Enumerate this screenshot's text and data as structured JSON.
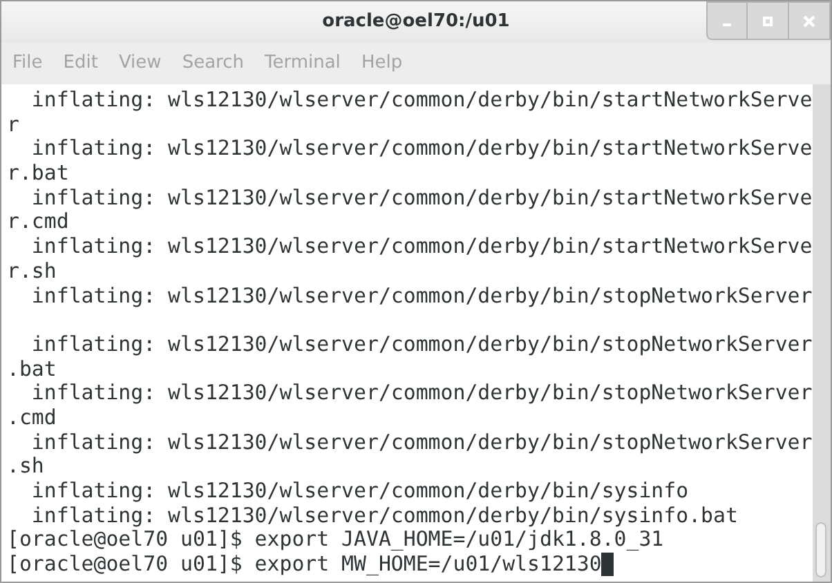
{
  "window": {
    "title": "oracle@oel70:/u01"
  },
  "menu": [
    "File",
    "Edit",
    "View",
    "Search",
    "Terminal",
    "Help"
  ],
  "terminal": {
    "lines": [
      {
        "kind": "text",
        "text": "  inflating: wls12130/wlserver/common/derby/bin/startNetworkServe"
      },
      {
        "kind": "text",
        "text": "r"
      },
      {
        "kind": "text",
        "text": "  inflating: wls12130/wlserver/common/derby/bin/startNetworkServe"
      },
      {
        "kind": "text",
        "text": "r.bat"
      },
      {
        "kind": "text",
        "text": "  inflating: wls12130/wlserver/common/derby/bin/startNetworkServe"
      },
      {
        "kind": "text",
        "text": "r.cmd"
      },
      {
        "kind": "text",
        "text": "  inflating: wls12130/wlserver/common/derby/bin/startNetworkServe"
      },
      {
        "kind": "text",
        "text": "r.sh"
      },
      {
        "kind": "text",
        "text": "  inflating: wls12130/wlserver/common/derby/bin/stopNetworkServer"
      },
      {
        "kind": "blank"
      },
      {
        "kind": "text",
        "text": "  inflating: wls12130/wlserver/common/derby/bin/stopNetworkServer"
      },
      {
        "kind": "text",
        "text": ".bat"
      },
      {
        "kind": "text",
        "text": "  inflating: wls12130/wlserver/common/derby/bin/stopNetworkServer"
      },
      {
        "kind": "text",
        "text": ".cmd"
      },
      {
        "kind": "text",
        "text": "  inflating: wls12130/wlserver/common/derby/bin/stopNetworkServer"
      },
      {
        "kind": "text",
        "text": ".sh"
      },
      {
        "kind": "text",
        "text": "  inflating: wls12130/wlserver/common/derby/bin/sysinfo"
      },
      {
        "kind": "text",
        "text": "  inflating: wls12130/wlserver/common/derby/bin/sysinfo.bat"
      },
      {
        "kind": "text",
        "text": "[oracle@oel70 u01]$ export JAVA_HOME=/u01/jdk1.8.0_31"
      },
      {
        "kind": "prompt",
        "text": "[oracle@oel70 u01]$ export MW_HOME=/u01/wls12130"
      }
    ]
  }
}
